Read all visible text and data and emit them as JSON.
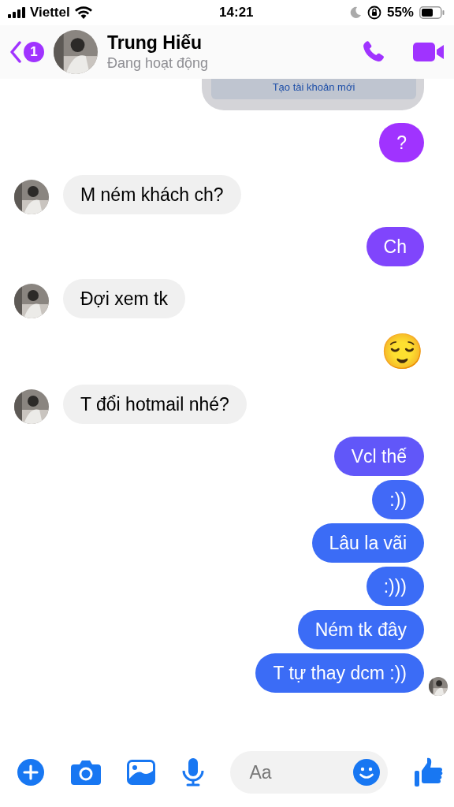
{
  "status_bar": {
    "carrier": "Viettel",
    "time": "14:21",
    "battery": "55%"
  },
  "header": {
    "back_badge": "1",
    "name": "Trung Hiếu",
    "status": "Đang hoạt động"
  },
  "messages": [
    {
      "kind": "card",
      "text": "Tạo tài khoản mới"
    },
    {
      "kind": "sent",
      "text": "?"
    },
    {
      "kind": "received",
      "text": "M ném khách ch?"
    },
    {
      "kind": "sent",
      "text": "Ch"
    },
    {
      "kind": "received",
      "text": "Đợi xem tk"
    },
    {
      "kind": "emoji",
      "text": "😌"
    },
    {
      "kind": "received",
      "text": "T đổi hotmail nhé?"
    },
    {
      "kind": "sent",
      "text": "Vcl thế"
    },
    {
      "kind": "sent",
      "text": ":))"
    },
    {
      "kind": "sent",
      "text": "Lâu la vãi"
    },
    {
      "kind": "sent",
      "text": ":)))"
    },
    {
      "kind": "sent",
      "text": "Ném tk đây"
    },
    {
      "kind": "sent",
      "text": "T tự thay dcm :))",
      "seen": true
    }
  ],
  "composer": {
    "placeholder": "Aa"
  }
}
